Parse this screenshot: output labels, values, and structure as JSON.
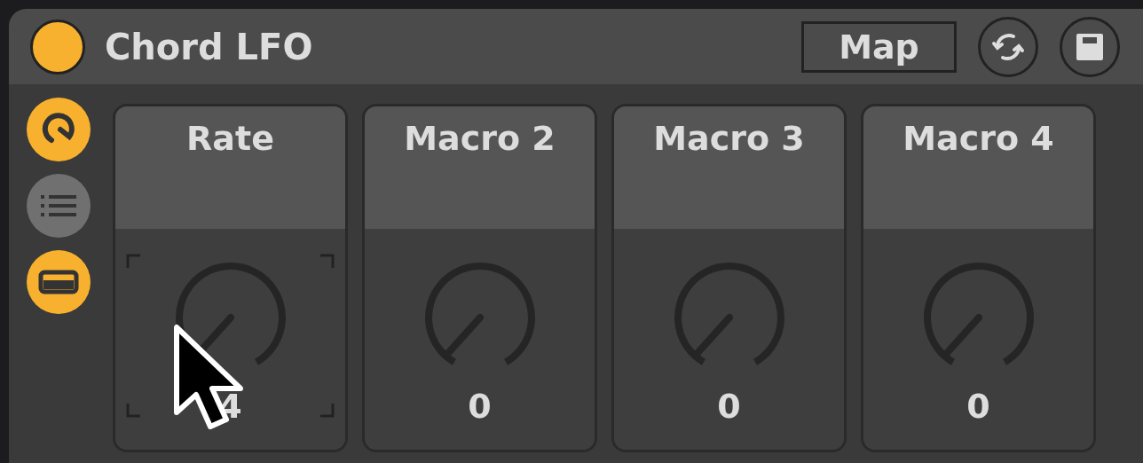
{
  "device": {
    "title": "Chord LFO",
    "power_on": true,
    "map_button": "Map"
  },
  "side_buttons": [
    {
      "kind": "hook",
      "on": true
    },
    {
      "kind": "list",
      "on": false
    },
    {
      "kind": "panel",
      "on": true
    }
  ],
  "macros": [
    {
      "label": "Rate",
      "value": "4",
      "selected": true
    },
    {
      "label": "Macro 2",
      "value": "0",
      "selected": false
    },
    {
      "label": "Macro 3",
      "value": "0",
      "selected": false
    },
    {
      "label": "Macro 4",
      "value": "0",
      "selected": false
    }
  ]
}
